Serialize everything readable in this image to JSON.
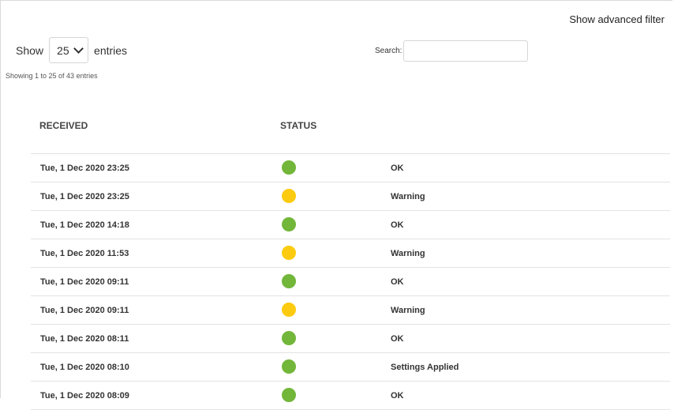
{
  "toolbar": {
    "advanced_filter_label": "Show advanced filter",
    "length_prefix": "Show",
    "length_value": "25",
    "length_suffix": "entries",
    "search_label": "Search:",
    "search_value": "",
    "info": "Showing 1 to 25 of 43 entries"
  },
  "table": {
    "headers": {
      "received": "RECEIVED",
      "status": "STATUS"
    },
    "status_colors": {
      "ok": "#72b63a",
      "warning": "#fccb0f"
    },
    "rows": [
      {
        "received": "Tue, 1 Dec 2020 23:25",
        "status": "ok",
        "status_text": "OK"
      },
      {
        "received": "Tue, 1 Dec 2020 23:25",
        "status": "warning",
        "status_text": "Warning"
      },
      {
        "received": "Tue, 1 Dec 2020 14:18",
        "status": "ok",
        "status_text": "OK"
      },
      {
        "received": "Tue, 1 Dec 2020 11:53",
        "status": "warning",
        "status_text": "Warning"
      },
      {
        "received": "Tue, 1 Dec 2020 09:11",
        "status": "ok",
        "status_text": "OK"
      },
      {
        "received": "Tue, 1 Dec 2020 09:11",
        "status": "warning",
        "status_text": "Warning"
      },
      {
        "received": "Tue, 1 Dec 2020 08:11",
        "status": "ok",
        "status_text": "OK"
      },
      {
        "received": "Tue, 1 Dec 2020 08:10",
        "status": "ok",
        "status_text": "Settings Applied"
      },
      {
        "received": "Tue, 1 Dec 2020 08:09",
        "status": "ok",
        "status_text": "OK"
      }
    ]
  }
}
